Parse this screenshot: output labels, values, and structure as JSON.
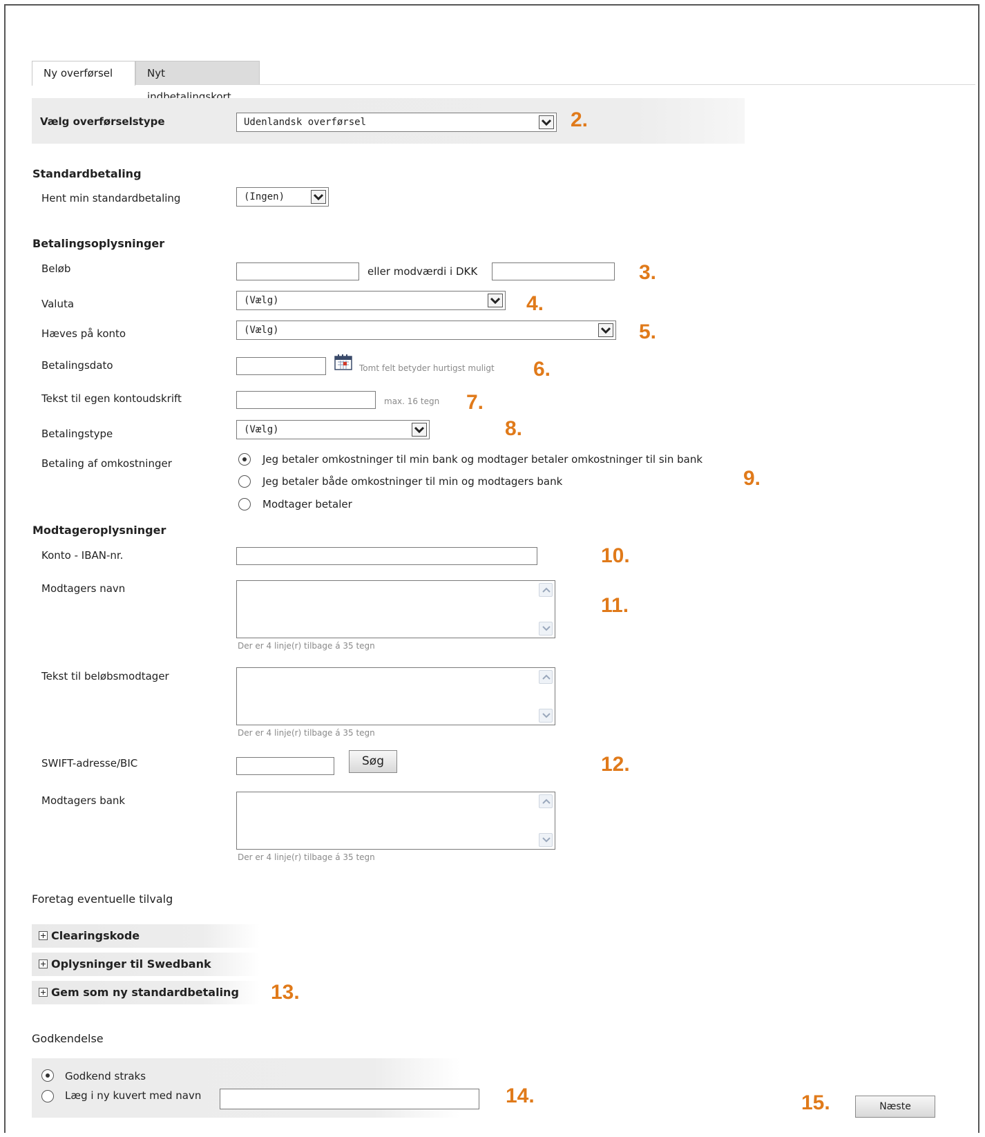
{
  "tabs": [
    {
      "label": "Ny overførsel",
      "active": true
    },
    {
      "label": "Nyt indbetalingskort",
      "active": false
    }
  ],
  "transfer_type": {
    "label": "Vælg overførselstype",
    "value": "Udenlandsk overførsel",
    "marker": "2."
  },
  "standard": {
    "heading": "Standardbetaling",
    "fetch_label": "Hent min standardbetaling",
    "fetch_value": "(Ingen)"
  },
  "payment": {
    "heading": "Betalingsoplysninger",
    "amount_label": "Beløb",
    "dkk_label": "eller modværdi i DKK",
    "amount_marker": "3.",
    "currency_label": "Valuta",
    "currency_value": "(Vælg)",
    "currency_marker": "4.",
    "account_label": "Hæves på konto",
    "account_value": "(Vælg)",
    "account_marker": "5.",
    "date_label": "Betalingsdato",
    "date_hint": "Tomt felt betyder hurtigst muligt",
    "date_marker": "6.",
    "own_text_label": "Tekst til egen kontoudskrift",
    "own_text_hint": "max. 16 tegn",
    "own_text_marker": "7.",
    "pay_type_label": "Betalingstype",
    "pay_type_value": "(Vælg)",
    "pay_type_marker": "8.",
    "costs_label": "Betaling af omkostninger",
    "costs_options": [
      {
        "label": "Jeg betaler omkostninger til min bank og modtager betaler omkostninger til sin bank",
        "selected": true
      },
      {
        "label": "Jeg betaler både omkostninger til min og modtagers bank",
        "selected": false
      },
      {
        "label": "Modtager betaler",
        "selected": false
      }
    ],
    "costs_marker": "9."
  },
  "recipient": {
    "heading": "Modtageroplysninger",
    "iban_label": "Konto - IBAN-nr.",
    "iban_marker": "10.",
    "name_label": "Modtagers navn",
    "name_hint": "Der er 4 linje(r) tilbage á 35 tegn",
    "name_marker": "11.",
    "text_label": "Tekst til beløbsmodtager",
    "text_hint": "Der er 4 linje(r) tilbage á 35 tegn",
    "swift_label": "SWIFT-adresse/BIC",
    "search_button": "Søg",
    "swift_marker": "12.",
    "bank_label": "Modtagers bank",
    "bank_hint": "Der er 4 linje(r) tilbage á 35 tegn"
  },
  "options": {
    "heading": "Foretag eventuelle tilvalg",
    "items": [
      "Clearingskode",
      "Oplysninger til Swedbank",
      "Gem som ny standardbetaling"
    ],
    "marker": "13."
  },
  "approval": {
    "heading": "Godkendelse",
    "options": [
      {
        "label": "Godkend straks",
        "selected": true
      },
      {
        "label": "Læg i ny kuvert med navn",
        "selected": false
      }
    ],
    "marker": "14."
  },
  "next": {
    "label": "Næste",
    "marker": "15."
  },
  "colors": {
    "marker": "#e07a1a",
    "panel": "#ececec"
  },
  "icons": [
    "chevron-down-icon",
    "calendar-icon",
    "scroll-up-icon",
    "scroll-down-icon",
    "expand-plus-icon"
  ]
}
